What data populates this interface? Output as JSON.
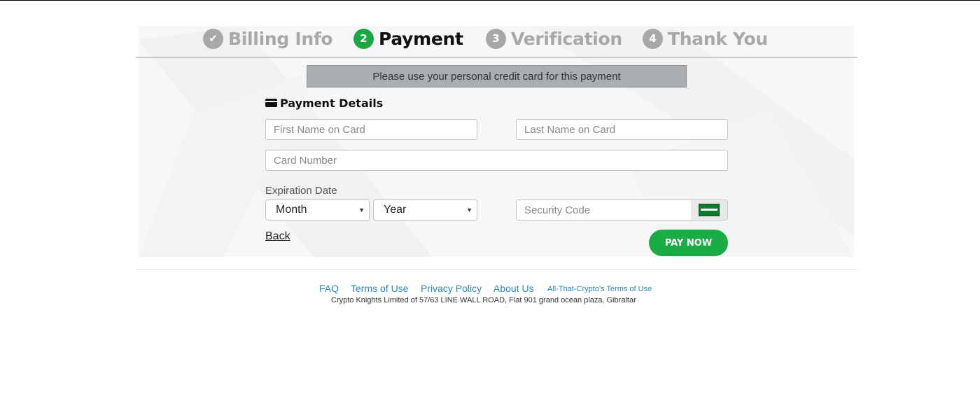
{
  "stepper": {
    "steps": [
      {
        "label": "Billing Info",
        "badge": "✔",
        "state": "done"
      },
      {
        "label": "Payment",
        "badge": "2",
        "state": "active"
      },
      {
        "label": "Verification",
        "badge": "3",
        "state": "pending"
      },
      {
        "label": "Thank You",
        "badge": "4",
        "state": "pending"
      }
    ]
  },
  "notice": "Please use your personal credit card for this payment",
  "payment_details": {
    "title": "Payment Details",
    "icon": "credit-card-icon",
    "first_name_placeholder": "First Name on Card",
    "last_name_placeholder": "Last Name on Card",
    "card_number_placeholder": "Card Number",
    "expiration_label": "Expiration Date",
    "month_value": "Month",
    "year_value": "Year",
    "security_code_placeholder": "Security Code",
    "cvv_icon": "card-back-icon"
  },
  "actions": {
    "back_label": "Back",
    "pay_label": "PAY NOW"
  },
  "footer": {
    "links": [
      "FAQ",
      "Terms of Use",
      "Privacy Policy",
      "About Us",
      "All-That-Crypto's Terms of Use"
    ],
    "address": "Crypto Knights Limited of 57/63 LINE WALL ROAD, Flat 901 grand ocean plaza, Gibraltar"
  },
  "colors": {
    "accent_green": "#1aad46",
    "inactive_gray": "#a8a8a8",
    "link_blue": "#2a88c4",
    "notice_bg": "#a9aeb0"
  }
}
